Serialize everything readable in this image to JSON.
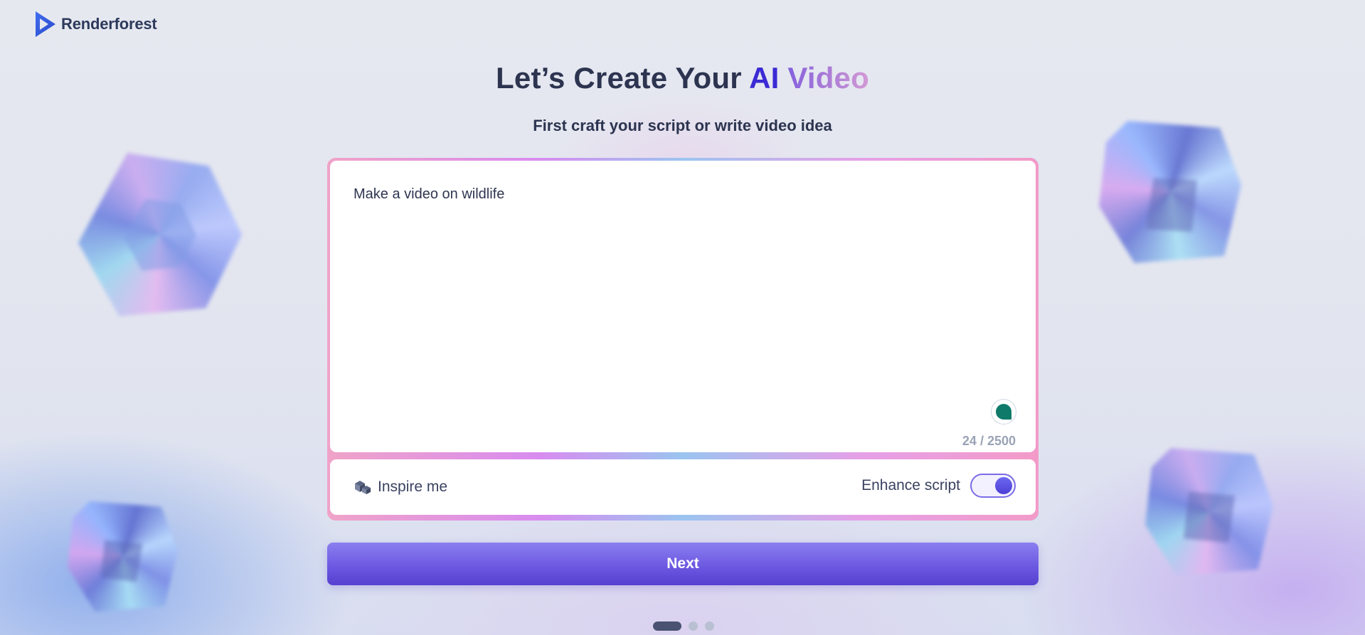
{
  "brand": {
    "name": "Renderforest"
  },
  "heading": {
    "prefix": "Let’s Create Your ",
    "ai": "AI",
    "video": " Video"
  },
  "subtitle": "First craft your script or write video idea",
  "editor": {
    "text": "Make a video on wildlife",
    "char_count": "24",
    "char_limit": "2500",
    "separator": " / "
  },
  "controls": {
    "inspire_label": "Inspire me",
    "enhance_label": "Enhance script",
    "enhance_on": true
  },
  "next_label": "Next",
  "pager": {
    "total": 3,
    "active": 1
  },
  "colors": {
    "accent": "#5b49dc",
    "ai_color": "#3a2bd4",
    "assist_icon": "#0f7a6a"
  }
}
